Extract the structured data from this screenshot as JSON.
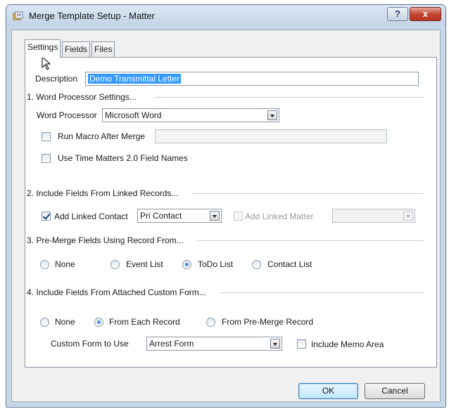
{
  "window": {
    "title": "Merge Template Setup - Matter",
    "help_label": "?",
    "close_label": "x"
  },
  "tabs": [
    "Settings",
    "Fields",
    "Files"
  ],
  "description": {
    "label": "Description",
    "value": "Demo Transmittal Letter"
  },
  "section1": {
    "heading": "1. Word Processor Settings...",
    "word_processor_label": "Word Processor",
    "word_processor_value": "Microsoft Word",
    "run_macro_label": "Run Macro After Merge",
    "run_macro_checked": false,
    "run_macro_value": "",
    "tm20_label": "Use Time Matters 2.0 Field Names",
    "tm20_checked": false
  },
  "section2": {
    "heading": "2. Include Fields From Linked Records...",
    "add_linked_contact_label": "Add Linked Contact",
    "add_linked_contact_checked": true,
    "linked_contact_value": "Pri Contact",
    "add_linked_matter_label": "Add Linked Matter",
    "add_linked_matter_checked": false,
    "linked_matter_value": ""
  },
  "section3": {
    "heading": "3. Pre-Merge Fields Using Record From...",
    "options": [
      "None",
      "Event List",
      "ToDo List",
      "Contact List"
    ],
    "selected": "ToDo List"
  },
  "section4": {
    "heading": "4. Include Fields From Attached Custom Form...",
    "options": [
      "None",
      "From Each Record",
      "From Pre-Merge Record"
    ],
    "selected": "From Each Record",
    "custom_form_label": "Custom Form to Use",
    "custom_form_value": "Arrest Form",
    "include_memo_label": "Include Memo Area",
    "include_memo_checked": false
  },
  "buttons": {
    "ok": "OK",
    "cancel": "Cancel"
  },
  "colors": {
    "selection": "#3399ff",
    "close": "#c2412d",
    "frame": "#c8d7e8"
  }
}
